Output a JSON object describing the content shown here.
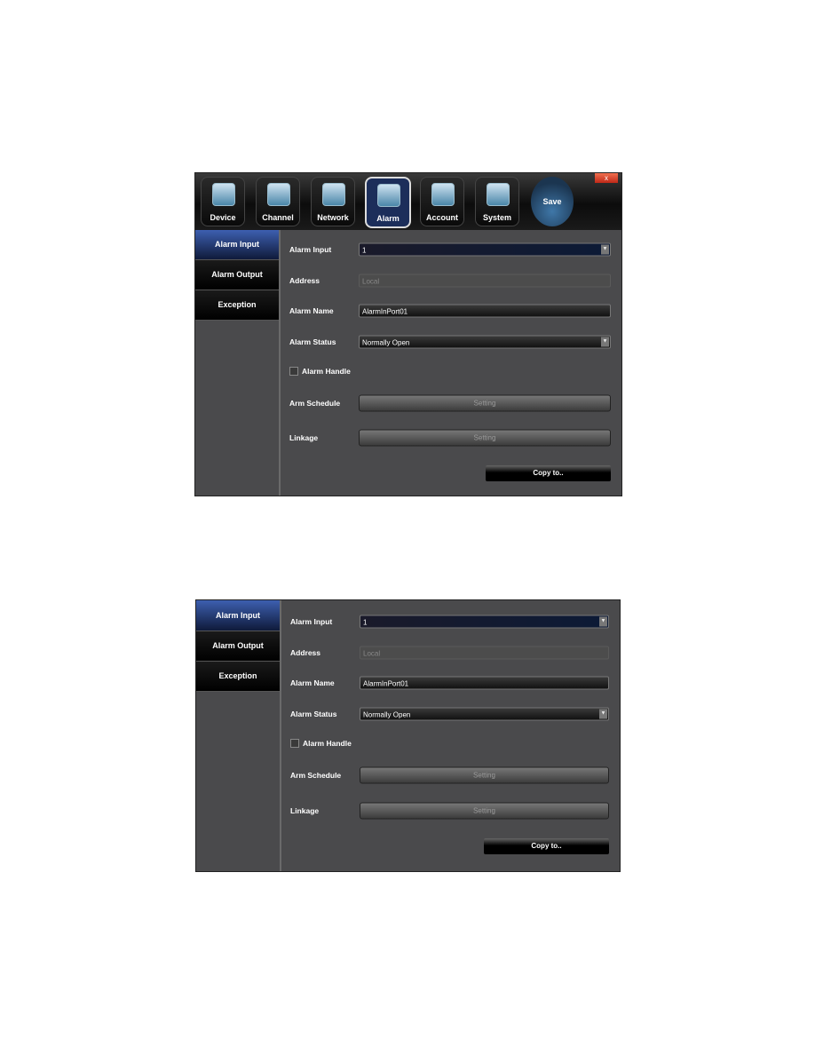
{
  "header": {
    "tabs": [
      {
        "label": "Device"
      },
      {
        "label": "Channel"
      },
      {
        "label": "Network"
      },
      {
        "label": "Alarm"
      },
      {
        "label": "Account"
      },
      {
        "label": "System"
      }
    ],
    "active_tab": "Alarm",
    "save_label": "Save",
    "close_label": "x"
  },
  "sidebar": {
    "items": [
      {
        "label": "Alarm Input"
      },
      {
        "label": "Alarm Output"
      },
      {
        "label": "Exception"
      }
    ],
    "active": "Alarm Input"
  },
  "form": {
    "alarm_input": {
      "label": "Alarm Input",
      "value": "1"
    },
    "address": {
      "label": "Address",
      "value": "Local"
    },
    "alarm_name": {
      "label": "Alarm Name",
      "value": "AlarmInPort01"
    },
    "alarm_status": {
      "label": "Alarm Status",
      "value": "Normally Open"
    },
    "alarm_handle": {
      "label": "Alarm Handle",
      "checked": false
    },
    "arm_schedule": {
      "label": "Arm Schedule",
      "button": "Setting"
    },
    "linkage": {
      "label": "Linkage",
      "button": "Setting"
    },
    "copy_label": "Copy to.."
  },
  "colors": {
    "panel_bg": "#4a4a4c",
    "active_blue": "#3d5fb0",
    "close_red": "#d03a20"
  }
}
